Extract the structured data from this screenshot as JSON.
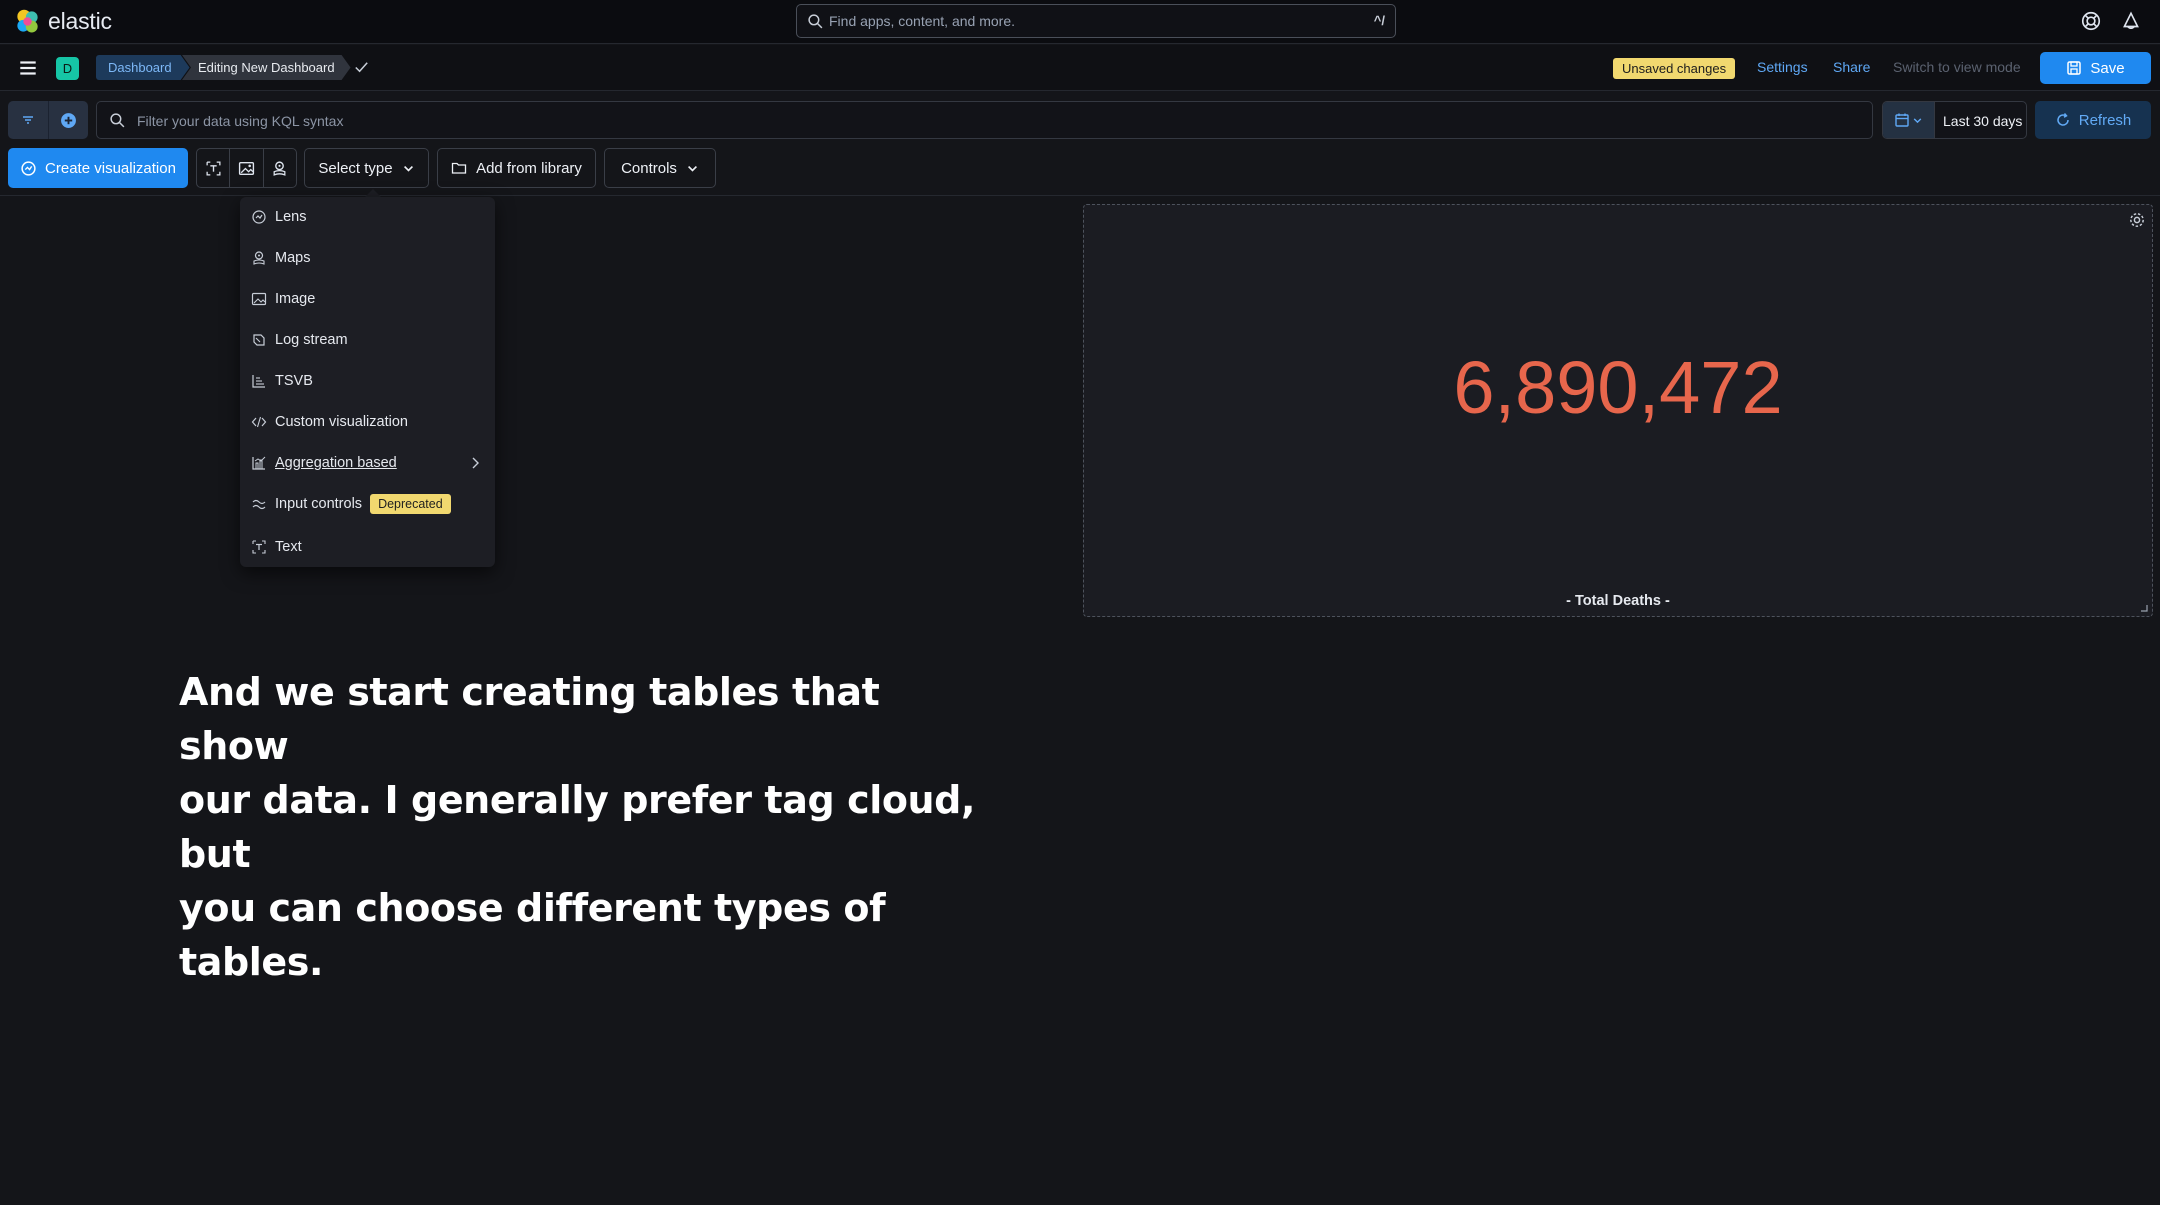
{
  "app": {
    "brand": "elastic"
  },
  "global_search": {
    "placeholder": "Find apps, content, and more.",
    "shortcut": "^/"
  },
  "nav": {
    "space_initial": "D",
    "breadcrumbs": [
      "Dashboard",
      "Editing New Dashboard"
    ],
    "unsaved_badge": "Unsaved changes",
    "settings_label": "Settings",
    "share_label": "Share",
    "view_mode_label": "Switch to view mode",
    "save_label": "Save"
  },
  "query": {
    "placeholder": "Filter your data using KQL syntax",
    "date_range": "Last 30 days",
    "refresh_label": "Refresh"
  },
  "toolbar": {
    "create_label": "Create visualization",
    "select_type_label": "Select type",
    "library_label": "Add from library",
    "controls_label": "Controls"
  },
  "type_menu": {
    "items": [
      {
        "label": "Lens",
        "icon": "lens-icon"
      },
      {
        "label": "Maps",
        "icon": "maps-icon"
      },
      {
        "label": "Image",
        "icon": "image-icon"
      },
      {
        "label": "Log stream",
        "icon": "log-stream-icon"
      },
      {
        "label": "TSVB",
        "icon": "tsvb-icon"
      },
      {
        "label": "Custom visualization",
        "icon": "code-icon"
      },
      {
        "label": "Aggregation based",
        "icon": "aggregation-icon"
      },
      {
        "label": "Input controls",
        "icon": "controls-icon",
        "badge": "Deprecated"
      },
      {
        "label": "Text",
        "icon": "text-icon"
      }
    ]
  },
  "panel": {
    "metric_value": "6,890,472",
    "metric_label": "- Total Deaths -",
    "metric_color": "#e7664c"
  },
  "caption": {
    "lines": [
      "And we start creating tables that show",
      "our data. I generally prefer tag cloud, but",
      "you can choose different types of tables."
    ]
  },
  "colors": {
    "accent": "#1f89f0",
    "badge_yellow": "#f1d86f",
    "background": "#141519"
  }
}
